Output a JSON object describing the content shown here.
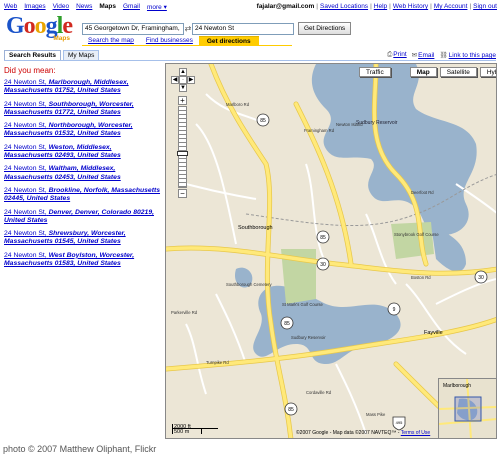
{
  "topnav": [
    "Web",
    "Images",
    "Video",
    "News",
    "Maps",
    "Gmail",
    "more ▾"
  ],
  "account": {
    "email": "fajalar@gmail.com",
    "links": [
      "Saved Locations",
      "Help",
      "Web History",
      "My Account",
      "Sign out"
    ]
  },
  "logo": {
    "text": "Google",
    "sub": "Maps"
  },
  "directions": {
    "from": "45 Georgetown Dr, Framingham, I",
    "to": "24 Newton St",
    "button": "Get Directions",
    "links": [
      "Search the map",
      "Find businesses"
    ],
    "active_link": "Get directions"
  },
  "tabs": [
    "Search Results",
    "My Maps"
  ],
  "tools": [
    "Print",
    "Email",
    "Link to this page"
  ],
  "did_you_mean": "Did you mean:",
  "results": [
    {
      "street": "24 Newton St,",
      "place": "Marlborough, Middlesex, Massachusetts 01752, United States"
    },
    {
      "street": "24 Newton St,",
      "place": "Southborough, Worcester, Massachusetts 01772, United States"
    },
    {
      "street": "24 Newton St,",
      "place": "Northborough, Worcester, Massachusetts 01532, United States"
    },
    {
      "street": "24 Newton St,",
      "place": "Weston, Middlesex, Massachusetts 02493, United States"
    },
    {
      "street": "24 Newton St,",
      "place": "Waltham, Middlesex, Massachusetts 02453, United States"
    },
    {
      "street": "24 Newton St,",
      "place": "Brookline, Norfolk, Massachusetts 02445, United States"
    },
    {
      "street": "24 Newton St,",
      "place": "Denver, Denver, Colorado 80219, United States"
    },
    {
      "street": "24 Newton St,",
      "place": "Shrewsbury, Worcester, Massachusetts 01545, United States"
    },
    {
      "street": "24 Newton St,",
      "place": "West Boylston, Worcester, Massachusetts 01583, United States"
    }
  ],
  "map": {
    "types": [
      "Traffic",
      "Map",
      "Satellite",
      "Hybrid"
    ],
    "active_type": "Map",
    "scale_ft": "2000 ft",
    "scale_m": "500 m",
    "copyright": "©2007 Google - Map data ©2007 NAVTEQ™ -",
    "terms": "Terms of Use",
    "labels": {
      "sudbury_reservoir": "Sudbury Reservoir",
      "newton_island": "Newton Island",
      "southborough": "Southborough",
      "stonybrook": "Stonybrook Golf Course",
      "cemetery": "Southborough Cemetery",
      "stmarks": "St Mark's Golf Course",
      "sudbury_res2": "Sudbury Reservoir",
      "fayville": "Fayville",
      "marlborough": "Marlborough",
      "r85": "85",
      "r30": "30",
      "r9": "9",
      "r495": "495",
      "marlboro_rd": "Marlboro Rd",
      "turnpike_rd": "Turnpike Rd",
      "boston_rd": "Boston Rd",
      "framingham_rd": "Framingham Rd",
      "parkerville_rd": "Parkerville Rd",
      "deerfoot_rd": "Deerfoot Rd",
      "cordaville_rd": "Cordaville Rd",
      "mass_pike": "Mass Pike"
    }
  },
  "credit": "photo © 2007 Matthew Oliphant, Flickr",
  "colors": {
    "link": "#0000cc",
    "highlight": "#ffcc00",
    "water": "#99b3cc",
    "park": "#c2d6a3",
    "road_major": "#ffe97a",
    "land": "#ece6d6"
  }
}
